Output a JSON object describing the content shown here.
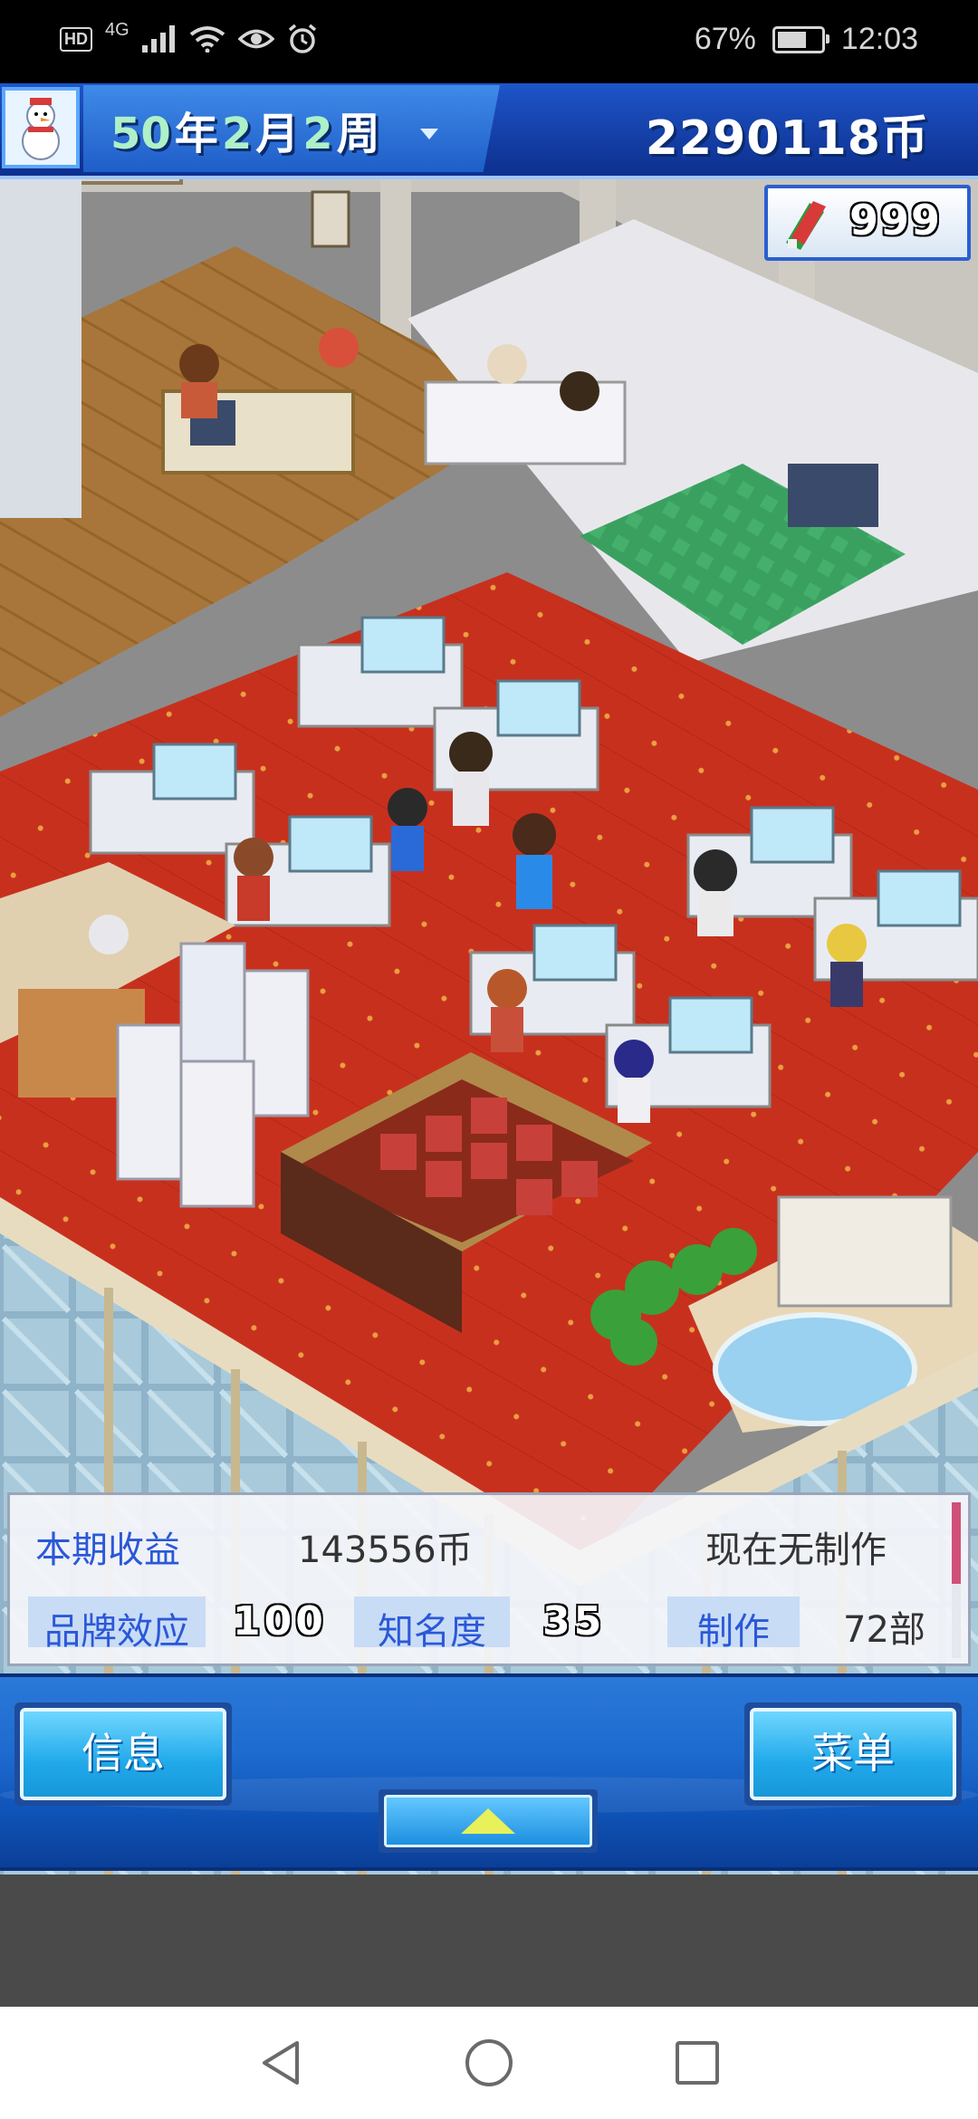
{
  "status_bar": {
    "left_badge": "HD",
    "network": "4G",
    "battery_percent": "67%",
    "battery_level": 0.67,
    "time": "12:03"
  },
  "hud": {
    "date": {
      "year": "50",
      "year_unit": "年",
      "month": "2",
      "month_unit": "月",
      "week": "2",
      "week_unit": "周"
    },
    "money": "2290118币",
    "tickets": "999"
  },
  "info_panel": {
    "period_income_label": "本期收益",
    "period_income_value": "143556币",
    "production_status": "现在无制作",
    "brand_label": "品牌效应",
    "brand_value": "100",
    "fame_label": "知名度",
    "fame_value": "35",
    "production_label": "制作",
    "production_count": "72部"
  },
  "controls": {
    "info_button": "信息",
    "menu_button": "菜单"
  },
  "colors": {
    "carpet": "#c8301e",
    "hud_blue": "#1e55c8",
    "label_blue": "#2b58d8",
    "button_cyan": "#21a9ea"
  }
}
